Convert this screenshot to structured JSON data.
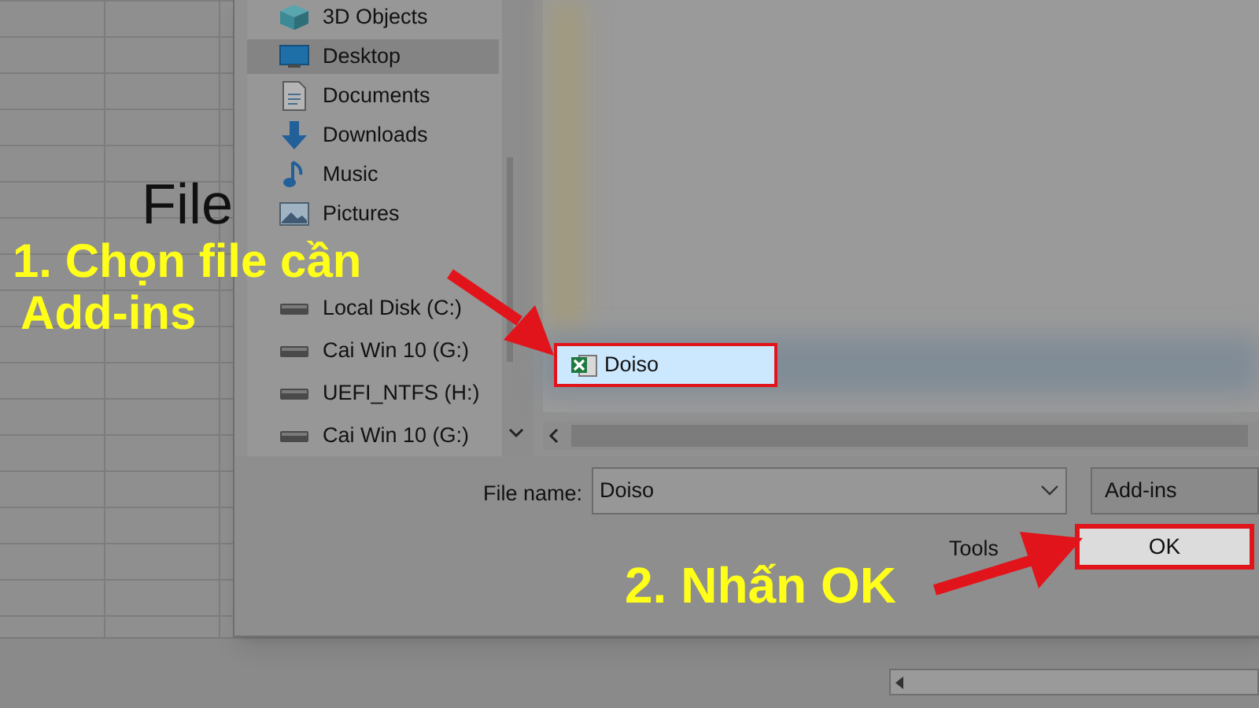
{
  "spreadsheet": {
    "cell_text": "File"
  },
  "dialog": {
    "nav_items": [
      {
        "kind": "objects",
        "label": "3D Objects",
        "selected": false
      },
      {
        "kind": "desktop",
        "label": "Desktop",
        "selected": true
      },
      {
        "kind": "documents",
        "label": "Documents",
        "selected": false
      },
      {
        "kind": "downloads",
        "label": "Downloads",
        "selected": false
      },
      {
        "kind": "music",
        "label": "Music",
        "selected": false
      },
      {
        "kind": "pictures",
        "label": "Pictures",
        "selected": false
      },
      {
        "kind": "drive",
        "label": "Local Disk (C:)",
        "selected": false
      },
      {
        "kind": "drive",
        "label": "Cai Win 10 (G:)",
        "selected": false
      },
      {
        "kind": "drive",
        "label": "UEFI_NTFS (H:)",
        "selected": false
      },
      {
        "kind": "drive",
        "label": "Cai Win 10 (G:)",
        "selected": false
      }
    ],
    "files": [
      {
        "name": "Doiso",
        "selected": true
      }
    ],
    "file_name_label": "File name:",
    "file_name_value": "Doiso",
    "file_type": "Add-ins",
    "tools": "Tools",
    "ok_button": "OK"
  },
  "annotations": [
    {
      "lines": [
        "1. Chọn file cần",
        "Add-ins"
      ]
    },
    {
      "lines": [
        "2. Nhấn OK"
      ]
    }
  ]
}
